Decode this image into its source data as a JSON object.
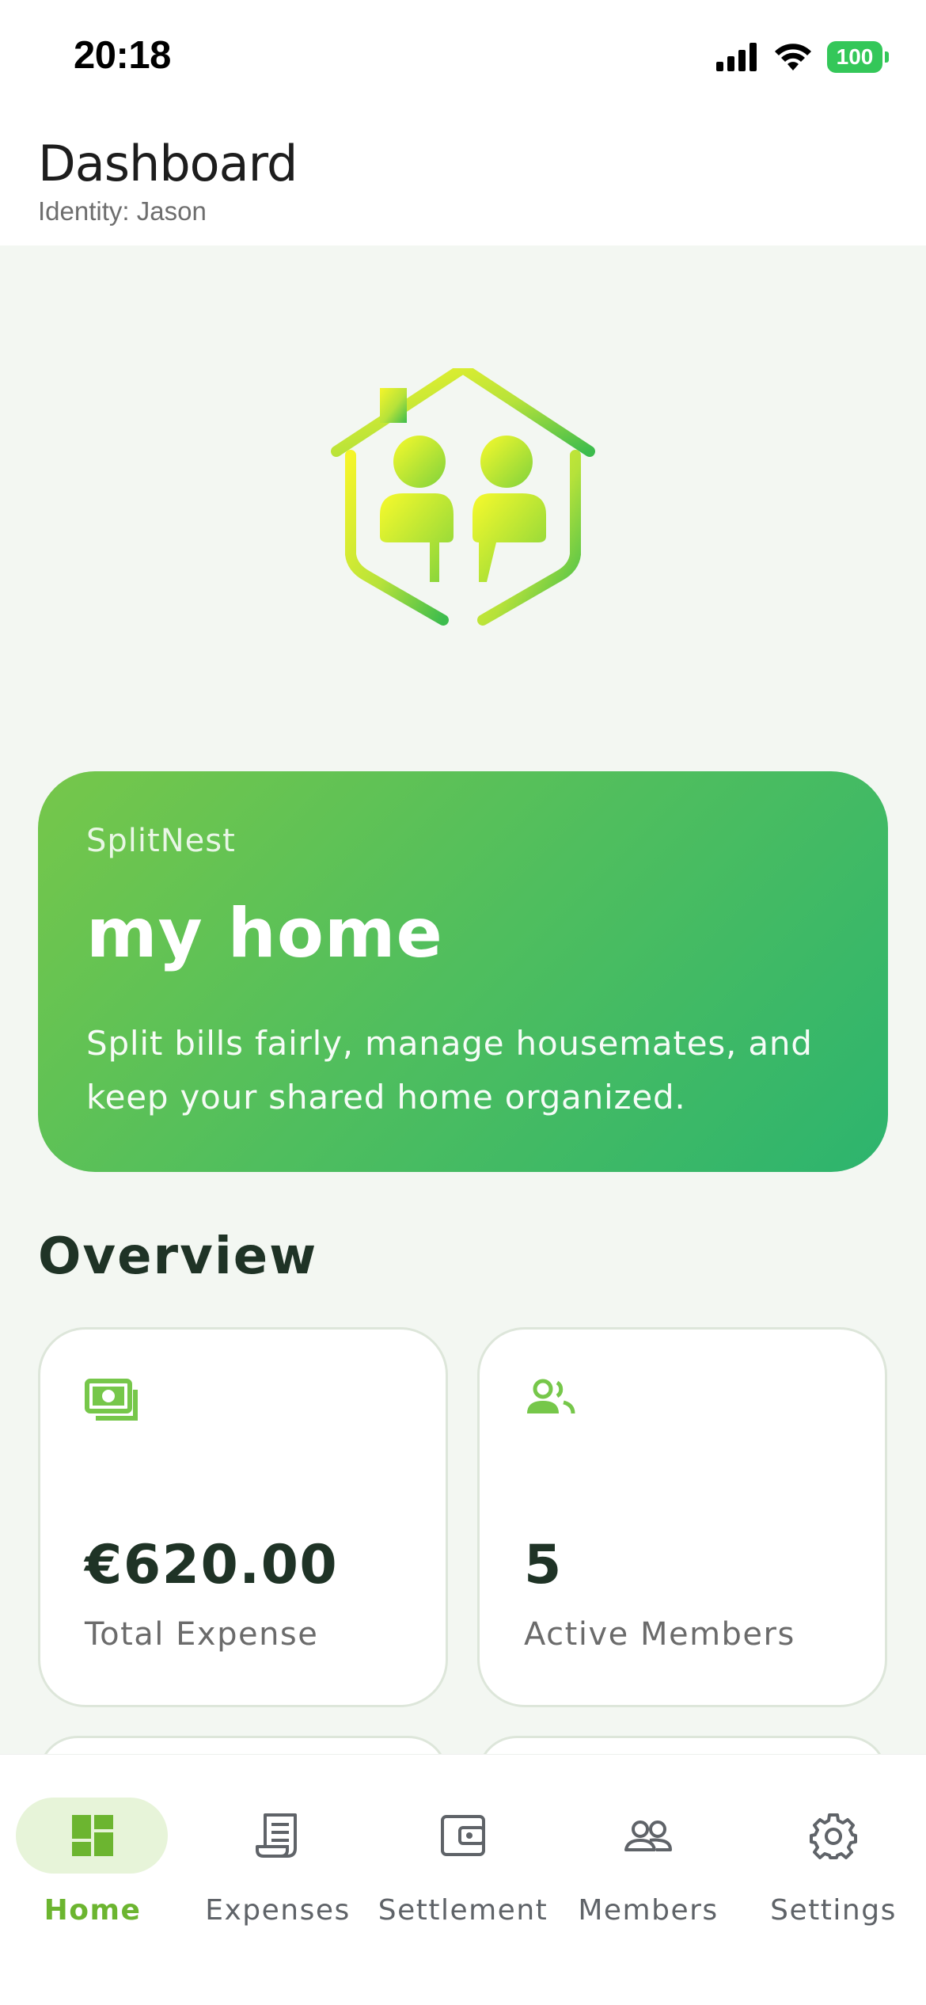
{
  "status_bar": {
    "time": "20:18",
    "battery": "100",
    "icons": [
      "cellular-signal-icon",
      "wifi-icon",
      "battery-icon"
    ]
  },
  "header": {
    "title": "Dashboard",
    "identity": "Identity: Jason"
  },
  "hero": {
    "brand": "SplitNest",
    "title": "my home",
    "description": "Split bills fairly, manage housemates, and keep your shared home organized."
  },
  "overview": {
    "title": "Overview",
    "stats": [
      {
        "icon": "money-icon",
        "value": "€620.00",
        "label": "Total Expense"
      },
      {
        "icon": "people-icon",
        "value": "5",
        "label": "Active Members"
      }
    ]
  },
  "nav": {
    "items": [
      {
        "label": "Home",
        "icon": "dashboard-icon",
        "active": true
      },
      {
        "label": "Expenses",
        "icon": "receipt-icon",
        "active": false
      },
      {
        "label": "Settlement",
        "icon": "wallet-icon",
        "active": false
      },
      {
        "label": "Members",
        "icon": "members-icon",
        "active": false
      },
      {
        "label": "Settings",
        "icon": "gear-icon",
        "active": false
      }
    ]
  },
  "colors": {
    "accent": "#6cb530",
    "hero_gradient_start": "#76c74a",
    "hero_gradient_end": "#2db46e",
    "background": "#f3f7f2"
  }
}
